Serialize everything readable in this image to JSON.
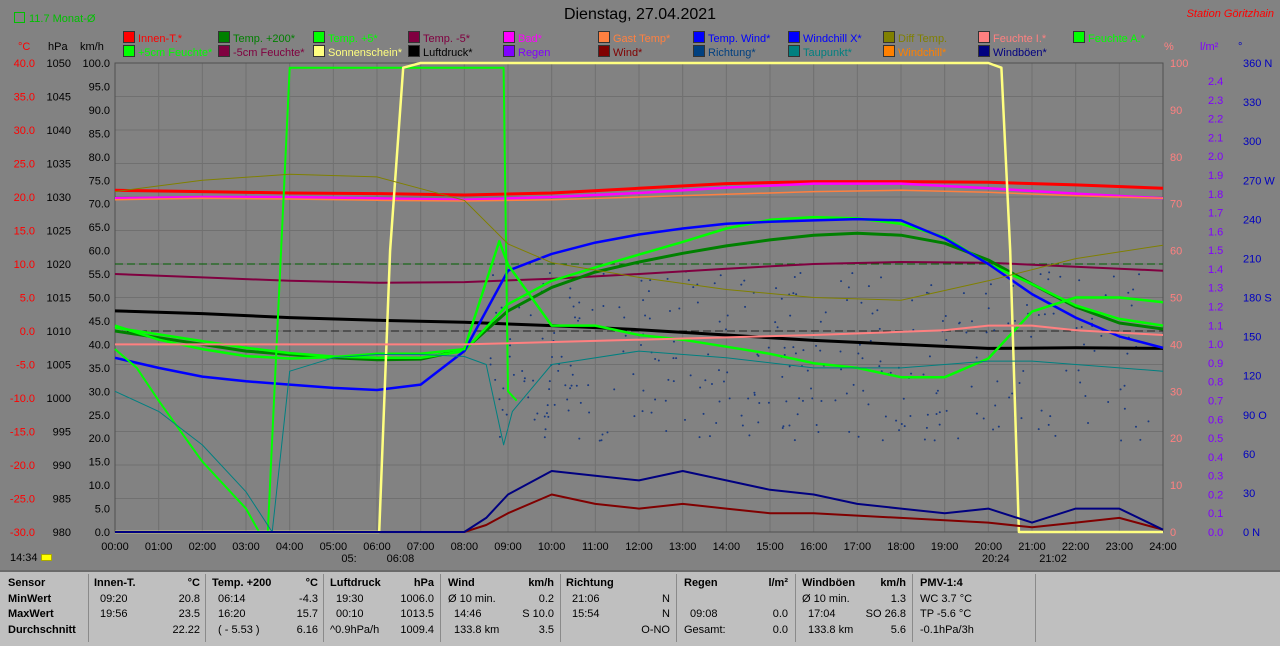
{
  "header": {
    "title": "Dienstag, 27.04.2021",
    "station": "Station Göritzhain",
    "month_avg": "11.7 Monat-Ø",
    "time_left": "14:34"
  },
  "axes_headers": {
    "c": "°C",
    "hpa": "hPa",
    "kmh": "km/h",
    "pct": "%",
    "lm2": "l/m²",
    "deg": "°"
  },
  "legend": [
    {
      "label": "Innen-T.*",
      "color": "#ff0000"
    },
    {
      "label": "Temp. +200*",
      "color": "#008000"
    },
    {
      "label": "Temp. +5*",
      "color": "#00ff00"
    },
    {
      "label": "Temp. -5*",
      "color": "#800040"
    },
    {
      "label": "Bad*",
      "color": "#ff00ff"
    },
    {
      "label": "Gast Temp*",
      "color": "#ff8040"
    },
    {
      "label": "Temp. Wind*",
      "color": "#0000ff"
    },
    {
      "label": "Windchill X*",
      "color": "#0000ff"
    },
    {
      "label": "Diff Temp.",
      "color": "#808000"
    },
    {
      "label": "Feuchte I.*",
      "color": "#ff8080"
    },
    {
      "label": "Feuchte A.*",
      "color": "#00ff00"
    },
    {
      "label": "+5cm Feuchte*",
      "color": "#00ff00"
    },
    {
      "label": "-5cm Feuchte*",
      "color": "#800040"
    },
    {
      "label": "Sonnenschein*",
      "color": "#ffff80"
    },
    {
      "label": "Luftdruck*",
      "color": "#000000"
    },
    {
      "label": "Regen",
      "color": "#8000ff"
    },
    {
      "label": "Wind*",
      "color": "#800000"
    },
    {
      "label": "Richtung*",
      "color": "#004080"
    },
    {
      "label": "Taupunkt*",
      "color": "#008080"
    },
    {
      "label": "Windchill*",
      "color": "#ff8000"
    },
    {
      "label": "Windböen*",
      "color": "#000080"
    }
  ],
  "axis_ticks": {
    "c": [
      "40.0",
      "35.0",
      "30.0",
      "25.0",
      "20.0",
      "15.0",
      "10.0",
      "5.0",
      "0.0",
      "-5.0",
      "-10.0",
      "-15.0",
      "-20.0",
      "-25.0",
      "-30.0"
    ],
    "hpa": [
      "1050",
      "1045",
      "1040",
      "1035",
      "1030",
      "1025",
      "1020",
      "1015",
      "1010",
      "1005",
      "1000",
      "995",
      "990",
      "985",
      "980"
    ],
    "kmh": [
      "100.0",
      "95.0",
      "90.0",
      "85.0",
      "80.0",
      "75.0",
      "70.0",
      "65.0",
      "60.0",
      "55.0",
      "50.0",
      "45.0",
      "40.0",
      "35.0",
      "30.0",
      "25.0",
      "20.0",
      "15.0",
      "10.0",
      "5.0",
      "0.0"
    ],
    "pct": [
      "100",
      "90",
      "80",
      "70",
      "60",
      "50",
      "40",
      "30",
      "20",
      "10",
      "0"
    ],
    "lm2": [
      "2.4",
      "2.3",
      "2.2",
      "2.1",
      "2.0",
      "1.9",
      "1.8",
      "1.7",
      "1.6",
      "1.5",
      "1.4",
      "1.3",
      "1.2",
      "1.1",
      "1.0",
      "0.9",
      "0.8",
      "0.7",
      "0.6",
      "0.5",
      "0.4",
      "0.3",
      "0.2",
      "0.1",
      "0.0"
    ],
    "deg": [
      "360 N",
      "330",
      "300",
      "270 W",
      "240",
      "210",
      "180 S",
      "150",
      "120",
      "90 O",
      "60",
      "30",
      "0 N"
    ],
    "time": [
      "00:00",
      "01:00",
      "02:00",
      "03:00",
      "04:00",
      "05:00",
      "06:00",
      "07:00",
      "08:00",
      "09:00",
      "10:00",
      "11:00",
      "12:00",
      "13:00",
      "14:00",
      "15:00",
      "16:00",
      "17:00",
      "18:00",
      "19:00",
      "20:00",
      "21:00",
      "22:00",
      "23:00",
      "24:00"
    ]
  },
  "sun_markers": {
    "sunrise": "05:",
    "sunrise2": "06:08",
    "sunset": "20:24",
    "sunset2": "21:02"
  },
  "chart_data": {
    "type": "line",
    "title": "Dienstag, 27.04.2021",
    "x_unit": "hour",
    "xlim": [
      0,
      24
    ],
    "ylim_temp": [
      -30,
      40
    ],
    "ylim_pct": [
      0,
      100
    ],
    "series": [
      {
        "name": "Innen-T.*",
        "axis": "temp",
        "color": "#ff0000",
        "x": [
          0,
          2,
          4,
          6,
          8,
          10,
          12,
          14,
          16,
          18,
          20,
          22,
          24
        ],
        "y": [
          21.0,
          20.8,
          20.6,
          20.5,
          20.3,
          20.6,
          21.3,
          22.0,
          22.3,
          22.3,
          22.2,
          21.8,
          21.3
        ]
      },
      {
        "name": "Bad*",
        "axis": "temp",
        "color": "#ff00ff",
        "x": [
          0,
          2,
          4,
          6,
          8,
          10,
          12,
          14,
          16,
          18,
          20,
          22,
          24
        ],
        "y": [
          19.8,
          20.0,
          20.0,
          19.8,
          19.6,
          20.0,
          20.6,
          21.4,
          22.0,
          22.0,
          21.3,
          20.5,
          19.8
        ]
      },
      {
        "name": "Gast Temp*",
        "axis": "temp",
        "color": "#ff8040",
        "x": [
          0,
          2,
          4,
          6,
          8,
          10,
          12,
          14,
          16,
          18,
          20,
          22,
          24
        ],
        "y": [
          19.6,
          19.8,
          19.7,
          19.5,
          19.4,
          19.6,
          20.0,
          20.4,
          20.8,
          21.0,
          20.7,
          20.2,
          19.8
        ]
      },
      {
        "name": "Temp. -5*",
        "axis": "temp",
        "color": "#800040",
        "x": [
          0,
          2,
          4,
          6,
          8,
          10,
          12,
          14,
          16,
          18,
          20,
          22,
          24
        ],
        "y": [
          8.5,
          8.0,
          7.5,
          7.2,
          7.3,
          7.8,
          8.5,
          9.3,
          10.0,
          10.3,
          10.2,
          9.6,
          9.0
        ]
      },
      {
        "name": "Luftdruck*",
        "axis": "temp",
        "color": "#000000",
        "x": [
          0,
          2,
          4,
          6,
          8,
          10,
          12,
          14,
          16,
          18,
          20,
          22,
          24
        ],
        "y": [
          3.0,
          2.6,
          2.0,
          1.6,
          1.3,
          0.8,
          0.2,
          -0.6,
          -1.4,
          -2.0,
          -2.6,
          -2.5,
          -2.6
        ]
      },
      {
        "name": "Temp. +200*",
        "axis": "temp",
        "color": "#008000",
        "x": [
          0,
          1,
          2,
          3,
          4,
          5,
          6,
          7,
          8,
          9,
          10,
          11,
          12,
          13,
          14,
          15,
          16,
          17,
          18,
          19,
          20,
          21,
          22,
          23,
          24
        ],
        "y": [
          0,
          -1,
          -2,
          -3,
          -3.5,
          -4,
          -4.3,
          -4.2,
          -2.8,
          3,
          6.5,
          8.8,
          10.3,
          11.6,
          12.7,
          13.6,
          14.3,
          14.6,
          14.3,
          13.1,
          10.6,
          7.0,
          3.6,
          1.2,
          0.3
        ]
      },
      {
        "name": "Temp. +5*",
        "axis": "temp",
        "color": "#00ff00",
        "x": [
          0,
          1,
          2,
          3,
          4,
          5,
          6,
          7,
          8,
          9,
          10,
          11,
          12,
          13,
          14,
          15,
          16,
          17,
          18,
          19,
          20,
          21,
          22,
          23,
          24
        ],
        "y": [
          0.5,
          -0.5,
          -1.5,
          -2.5,
          -3.3,
          -3.8,
          -4.0,
          -4.0,
          -3.0,
          4,
          7.5,
          9.5,
          11.4,
          13.3,
          15.3,
          16.6,
          17.0,
          16.8,
          16.0,
          14.0,
          10.0,
          7.0,
          3.8,
          1.8,
          0.8
        ]
      },
      {
        "name": "Temp. Wind*",
        "axis": "temp",
        "color": "#0000ff",
        "x": [
          0,
          1,
          2,
          3,
          4,
          5,
          6,
          7,
          8,
          9,
          10,
          11,
          12,
          13,
          14,
          15,
          16,
          17,
          18,
          19,
          20,
          21,
          22,
          23,
          24
        ],
        "y": [
          -4,
          -5.5,
          -6.8,
          -7.5,
          -8,
          -8.5,
          -8.8,
          -8,
          -3,
          9,
          11.5,
          13.2,
          14.4,
          15.3,
          16,
          16.3,
          16.5,
          16.7,
          16.5,
          13.8,
          10,
          5.5,
          2,
          -0.8,
          -2.5
        ]
      },
      {
        "name": "Feuchte A.*",
        "axis": "pct",
        "color": "#00ff00",
        "x": [
          0,
          1,
          2,
          3,
          4,
          5,
          6,
          7,
          8,
          8.8,
          9,
          10,
          11,
          12,
          13,
          14,
          15,
          16,
          17,
          18,
          19,
          20,
          21,
          22,
          23,
          24
        ],
        "y": [
          44,
          41,
          39,
          37.5,
          37,
          37.3,
          38,
          38,
          39,
          62,
          57,
          44,
          44,
          42,
          41,
          39.5,
          38,
          36,
          35,
          33,
          33,
          37,
          47,
          50,
          50,
          49
        ]
      },
      {
        "name": "+5cm Feuchte*",
        "axis": "pct",
        "color": "#00ff00",
        "x": [
          0,
          0.5,
          1,
          2,
          3,
          3.3,
          3.5,
          4,
          5,
          6,
          7,
          8,
          8.5,
          8.9,
          9,
          9.2
        ],
        "y": [
          39,
          35,
          28,
          15,
          5,
          0,
          0,
          99,
          99,
          99,
          99,
          99,
          99,
          99,
          30,
          28
        ]
      },
      {
        "name": "Sonnenschein*",
        "axis": "pct",
        "color": "#ffff80",
        "x": [
          0,
          5.7,
          6.05,
          6.3,
          6.6,
          7,
          20,
          20.3,
          20.5,
          20.7,
          24
        ],
        "y": [
          0,
          0,
          0,
          60,
          99,
          100,
          100,
          99,
          60,
          0,
          0
        ]
      },
      {
        "name": "Feuchte I.*",
        "axis": "pct",
        "color": "#ff8080",
        "x": [
          0,
          4,
          8,
          12,
          16,
          19,
          20,
          21,
          22,
          24
        ],
        "y": [
          40,
          40,
          40,
          41,
          42,
          43,
          44,
          44,
          43,
          42
        ]
      },
      {
        "name": "Diff Temp.",
        "axis": "temp",
        "color": "#808000",
        "x": [
          0,
          2,
          4,
          6,
          8,
          9,
          10,
          12,
          14,
          16,
          18,
          20,
          22,
          24
        ],
        "y": [
          20.8,
          22.5,
          23.4,
          23.0,
          19.5,
          13,
          10.2,
          8.0,
          6.2,
          5.0,
          4.6,
          7.5,
          10.8,
          12.8
        ]
      },
      {
        "name": "Taupunkt*",
        "axis": "temp",
        "color": "#008080",
        "x": [
          0,
          1,
          2,
          3,
          3.6,
          4,
          5,
          6,
          7,
          8,
          8.5,
          8.9,
          9.1,
          10,
          12,
          14,
          16,
          18,
          20,
          21,
          22,
          24
        ],
        "y": [
          -9,
          -12,
          -17,
          -24,
          -30,
          -6,
          -4,
          -3.5,
          -3.5,
          -3.8,
          -5,
          -17,
          -12,
          -5,
          -3,
          -4,
          -5.5,
          -5.5,
          -4.5,
          -4.5,
          -5,
          -6
        ]
      },
      {
        "name": "Wind*",
        "axis": "kmh",
        "color": "#800000",
        "x": [
          0,
          8,
          8.5,
          9,
          10,
          11,
          12,
          13,
          14,
          15,
          16,
          17,
          18,
          19,
          20,
          21,
          22,
          23,
          24
        ],
        "y": [
          0,
          0,
          1.5,
          4,
          8,
          6,
          5,
          6,
          5,
          4,
          4,
          3.5,
          3,
          2.5,
          2,
          1,
          2,
          3,
          0.5
        ]
      },
      {
        "name": "Windböen*",
        "axis": "kmh",
        "color": "#000080",
        "x": [
          0,
          8,
          8.5,
          9,
          10,
          11,
          12,
          13,
          14,
          15,
          16,
          17,
          18,
          19,
          20,
          21,
          22,
          23,
          24
        ],
        "y": [
          0,
          0,
          3,
          8,
          13,
          12,
          11,
          13,
          11,
          9,
          8,
          6,
          5,
          4,
          5,
          2,
          5,
          5,
          0.5
        ]
      }
    ]
  },
  "footer": {
    "sensor": {
      "head": "Sensor",
      "rows": [
        "MinWert",
        "MaxWert",
        "Durchschnitt"
      ]
    },
    "innen": {
      "head": "Innen-T.",
      "unit": "°C",
      "times": [
        "09:20",
        "19:56",
        ""
      ],
      "values": [
        "20.8",
        "23.5",
        "22.22"
      ]
    },
    "temp200": {
      "head": "Temp. +200",
      "unit": "°C",
      "times": [
        "06:14",
        "16:20",
        "( - 5.53 )"
      ],
      "values": [
        "-4.3",
        "15.7",
        "6.16"
      ]
    },
    "luftdruck": {
      "head": "Luftdruck",
      "unit": "hPa",
      "times": [
        "19:30",
        "00:10",
        "^0.9hPa/h"
      ],
      "values": [
        "1006.0",
        "1013.5",
        "1009.4"
      ]
    },
    "wind": {
      "head": "Wind",
      "unit": "km/h",
      "times": [
        "Ø 10 min.",
        "14:46",
        "133.8 km"
      ],
      "values": [
        "0.2",
        "S 10.0",
        "3.5"
      ]
    },
    "richtung": {
      "head": "Richtung",
      "unit": "",
      "times": [
        "21:06",
        "15:54",
        ""
      ],
      "values": [
        "N",
        "N",
        "O-NO"
      ]
    },
    "regen": {
      "head": "Regen",
      "unit": "l/m²",
      "times": [
        "",
        "09:08",
        "Gesamt:"
      ],
      "values": [
        "",
        "0.0",
        "0.0"
      ]
    },
    "windboeen": {
      "head": "Windböen",
      "unit": "km/h",
      "times": [
        "Ø 10 min.",
        "17:04",
        "133.8 km"
      ],
      "values": [
        "1.3",
        "SO 26.8",
        "5.6"
      ]
    },
    "pmv": {
      "head": "PMV-1:4",
      "rows": [
        "WC 3.7 °C",
        "TP -5.6 °C",
        "-0.1hPa/3h"
      ]
    }
  }
}
